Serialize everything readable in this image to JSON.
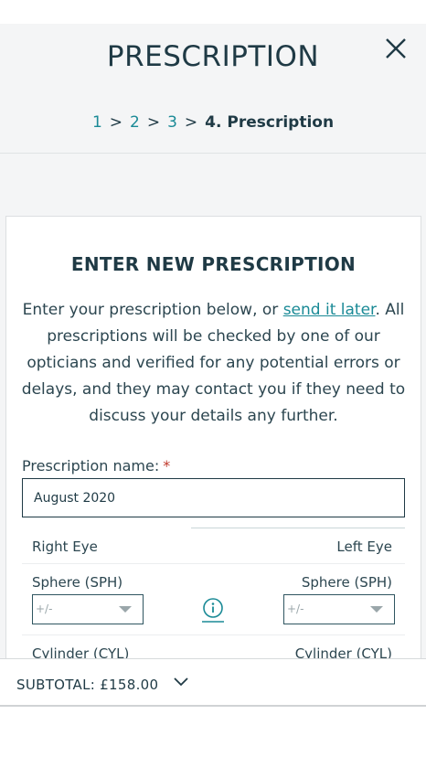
{
  "header": {
    "title": "PRESCRIPTION"
  },
  "breadcrumb": {
    "steps": [
      {
        "label": "1"
      },
      {
        "label": "2"
      },
      {
        "label": "3"
      }
    ],
    "separator": ">",
    "current": "4. Prescription"
  },
  "card": {
    "title": "ENTER NEW PRESCRIPTION",
    "intro_prefix": "Enter your prescription below, or ",
    "intro_link": "send it later",
    "intro_suffix": ". All prescriptions will be checked by one of our opticians and verified for any potential errors or delays, and they may contact you if they need to discuss your details any further."
  },
  "form": {
    "name_label": "Prescription name:",
    "required_mark": "*",
    "name_value": "August 2020",
    "right_eye": "Right Eye",
    "left_eye": "Left Eye",
    "sphere_label": "Sphere (SPH)",
    "sphere_right_value": "+/-",
    "sphere_left_value": "+/-",
    "cylinder_label": "Cylinder (CYL)"
  },
  "footer": {
    "subtotal": "SUBTOTAL: £158.00"
  },
  "icons": {
    "close": "close-icon",
    "info": "info-icon",
    "chevron": "chevron-down-icon"
  },
  "colors": {
    "primary_text": "#1f3a45",
    "accent": "#1a8a96",
    "required": "#c0392b"
  }
}
